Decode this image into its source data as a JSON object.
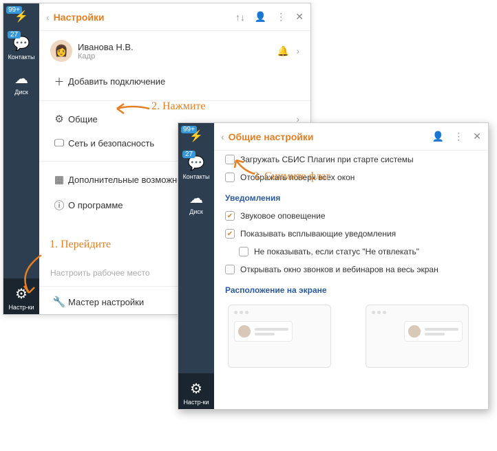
{
  "win1": {
    "badge": "99+",
    "chats_count": "27",
    "sb_contacts": "Контакты",
    "sb_disk": "Диск",
    "sb_settings": "Настр-ки",
    "title": "Настройки",
    "user_name": "Иванова Н.В.",
    "user_role": "Кадр",
    "add_conn": "Добавить подключение",
    "item_general": "Общие",
    "item_network": "Сеть и безопасность",
    "item_extra": "Дополнительные возможности",
    "item_about": "О программе",
    "workplace": "Настроить рабочее место",
    "wizard": "Мастер настройки"
  },
  "win2": {
    "badge": "99+",
    "chats_count": "27",
    "sb_contacts": "Контакты",
    "sb_disk": "Диск",
    "sb_settings": "Настр-ки",
    "title": "Общие настройки",
    "chk_autostart": "Загружать СБИС Плагин при старте системы",
    "chk_topmost": "Отображать поверх всех окон",
    "sect_notif": "Уведомления",
    "chk_sound": "Звуковое оповещение",
    "chk_popup": "Показывать всплывающие уведомления",
    "chk_dnd": "Не показывать, если статус \"Не отвлекать\"",
    "chk_fullscreen": "Открывать окно звонков и вебинаров на весь экран",
    "sect_position": "Расположение на экране"
  },
  "ann": {
    "a1": "1. Перейдите",
    "a2": "2. Нажмите",
    "a3": "3. Снимите флаг"
  }
}
